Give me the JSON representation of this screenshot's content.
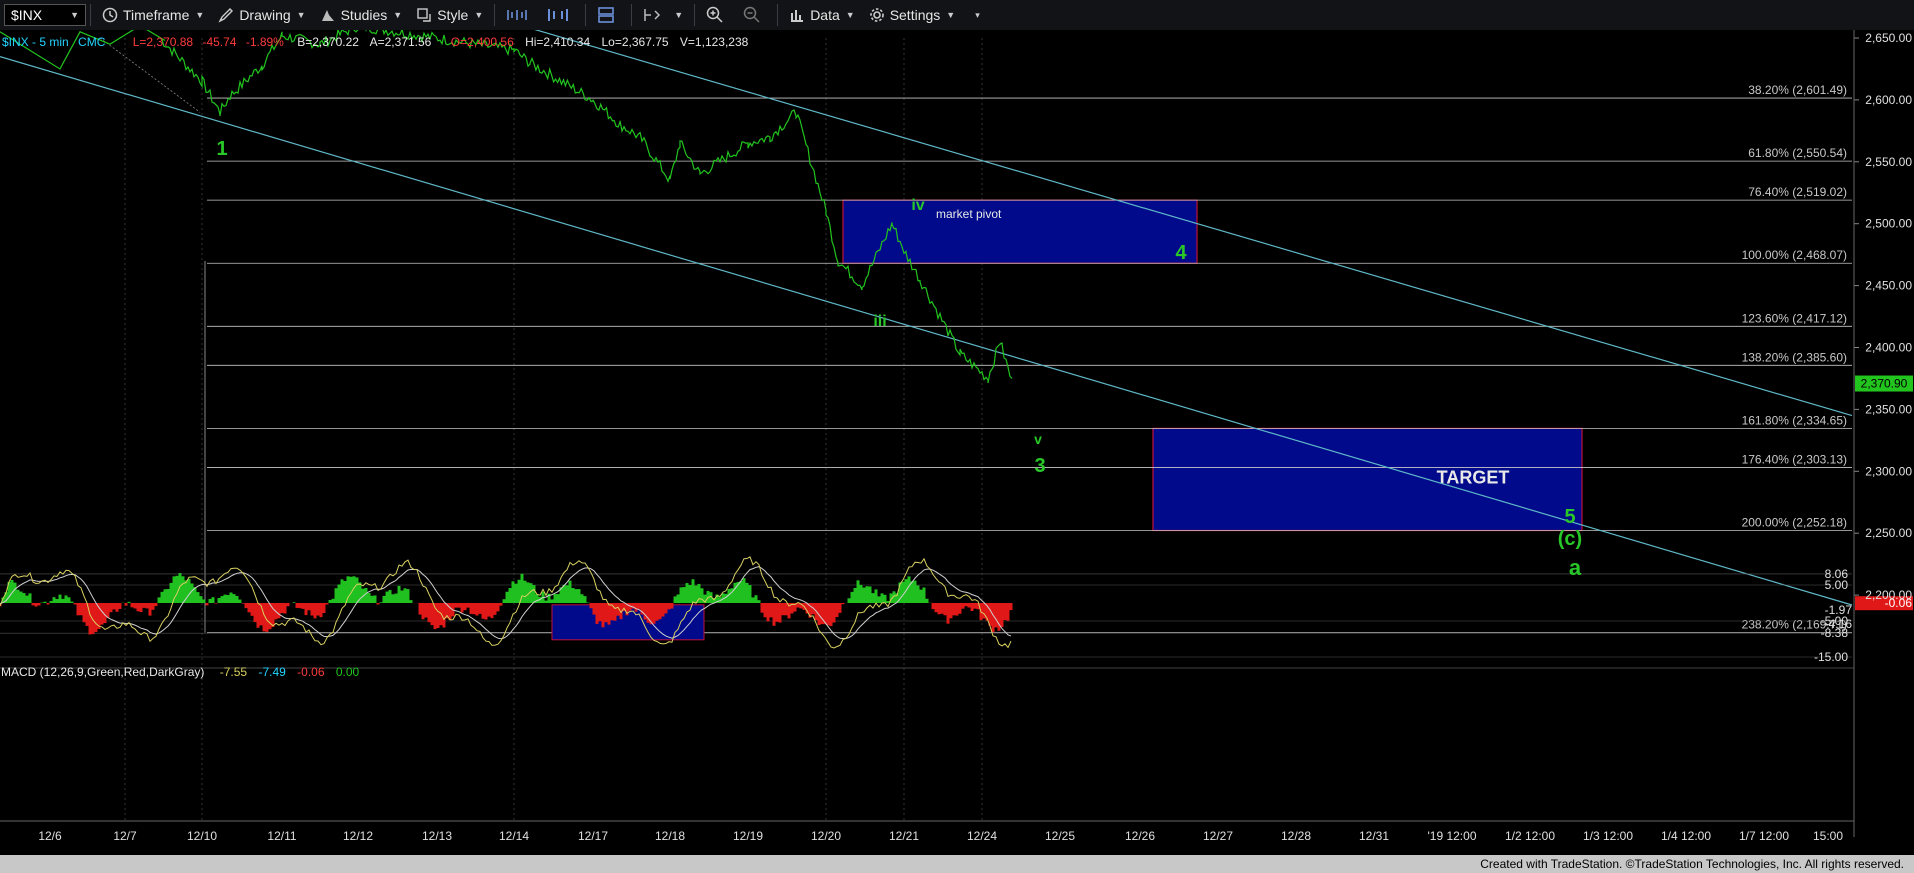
{
  "toolbar": {
    "symbol": "$INX",
    "items": [
      {
        "label": "Timeframe",
        "icon": "clock-icon"
      },
      {
        "label": "Drawing",
        "icon": "pencil-icon"
      },
      {
        "label": "Studies",
        "icon": "studies-icon"
      },
      {
        "label": "Style",
        "icon": "style-icon"
      },
      {
        "label": "Data",
        "icon": "data-icon"
      },
      {
        "label": "Settings",
        "icon": "gear-icon"
      }
    ]
  },
  "header": {
    "symbol_interval": "$INX - 5 min",
    "plot_type": "CMC",
    "last": "L=2,370.88",
    "change": "-45.74",
    "change_pct": "-1.89%",
    "bid": "B=2,370.22",
    "ask": "A=2,371.56",
    "open": "O=2,400.56",
    "high": "Hi=2,410.34",
    "low": "Lo=2,367.75",
    "volume": "V=1,123,238"
  },
  "colors": {
    "background": "#000000",
    "price_line": "#22c41e",
    "wave_label": "#28c828",
    "channel": "#5fb8c8",
    "fib_line": "#c8c8c8",
    "fib_text": "#c8c8c8",
    "box_fill": "#000a8a",
    "box_border": "#c0103a",
    "macd_up": "#20c020",
    "macd_down": "#e01818",
    "macd_line": "#d8d060",
    "signal_line": "#d0d0d0"
  },
  "chart_data": {
    "type": "line",
    "title": "$INX - 5 min",
    "y_axis": {
      "ticks": [
        "2,650.00",
        "2,600.00",
        "2,550.00",
        "2,500.00",
        "2,450.00",
        "2,400.00",
        "2,350.00",
        "2,300.00",
        "2,250.00",
        "2,200.00"
      ],
      "range": [
        2160,
        2665
      ]
    },
    "current_price": "2,370.90",
    "x_axis": {
      "ticks": [
        "12/6",
        "12/7",
        "12/10",
        "12/11",
        "12/12",
        "12/13",
        "12/14",
        "12/17",
        "12/18",
        "12/19",
        "12/20",
        "12/21",
        "12/24",
        "12/25",
        "12/26",
        "12/27",
        "12/28",
        "12/31",
        "'19 12:00",
        "1/2 12:00",
        "1/3 12:00",
        "1/4 12:00",
        "1/7 12:00",
        "15:00"
      ]
    },
    "fib_levels": [
      {
        "label": "38.20% (2,601.49)",
        "price": 2601.49
      },
      {
        "label": "61.80% (2,550.54)",
        "price": 2550.54
      },
      {
        "label": "76.40% (2,519.02)",
        "price": 2519.02
      },
      {
        "label": "100.00% (2,468.07)",
        "price": 2468.07
      },
      {
        "label": "123.60% (2,417.12)",
        "price": 2417.12
      },
      {
        "label": "138.20% (2,385.60)",
        "price": 2385.6
      },
      {
        "label": "161.80% (2,334.65)",
        "price": 2334.65
      },
      {
        "label": "176.40% (2,303.13)",
        "price": 2303.13
      },
      {
        "label": "200.00% (2,252.18)",
        "price": 2252.18
      },
      {
        "label": "238.20% (2,169.71)",
        "price": 2169.71
      }
    ],
    "price_series": [
      [
        "12/7",
        2650
      ],
      [
        "12/10",
        2615
      ],
      [
        "12/10",
        2590
      ],
      [
        "12/10",
        2603
      ],
      [
        "12/11",
        2628
      ],
      [
        "12/11",
        2652
      ],
      [
        "12/12",
        2645
      ],
      [
        "12/12",
        2660
      ],
      [
        "12/14",
        2640
      ],
      [
        "12/14",
        2630
      ],
      [
        "12/17",
        2600
      ],
      [
        "12/17",
        2580
      ],
      [
        "12/18",
        2570
      ],
      [
        "12/18",
        2535
      ],
      [
        "12/18",
        2565
      ],
      [
        "12/19",
        2540
      ],
      [
        "12/19",
        2565
      ],
      [
        "12/19",
        2570
      ],
      [
        "12/20",
        2590
      ],
      [
        "12/20",
        2510
      ],
      [
        "12/20",
        2470
      ],
      [
        "12/20",
        2450
      ],
      [
        "12/21",
        2500
      ],
      [
        "12/21",
        2475
      ],
      [
        "12/21",
        2455
      ],
      [
        "12/24",
        2395
      ],
      [
        "12/24",
        2375
      ],
      [
        "12/24",
        2405
      ],
      [
        "12/24",
        2372
      ]
    ],
    "boxes": [
      {
        "label": "market pivot",
        "from": "12/20",
        "to": "12/27",
        "top": 2519.02,
        "bottom": 2468.07
      },
      {
        "label": "TARGET",
        "from": "12/26",
        "to": "1/2 12:00",
        "top": 2334.65,
        "bottom": 2252.18
      }
    ],
    "wave_labels": [
      "1",
      "iii",
      "iv",
      "v",
      "3",
      "4",
      "5",
      "(c)",
      "a"
    ],
    "macd": {
      "title": "MACD (12,26,9,Green,Red,DarkGray)",
      "macd_value": "-7.55",
      "signal_value": "-7.49",
      "hist_value": "-0.06",
      "zero_value": "0.00",
      "axis_ticks": [
        "8.06",
        "5.00",
        "-5.00",
        "-8.38",
        "-15.00"
      ],
      "current_labels": [
        "-1.97",
        "-4.16",
        "-0.06"
      ]
    }
  },
  "footer": {
    "text": "Created with TradeStation. ©TradeStation Technologies, Inc. All rights reserved."
  }
}
